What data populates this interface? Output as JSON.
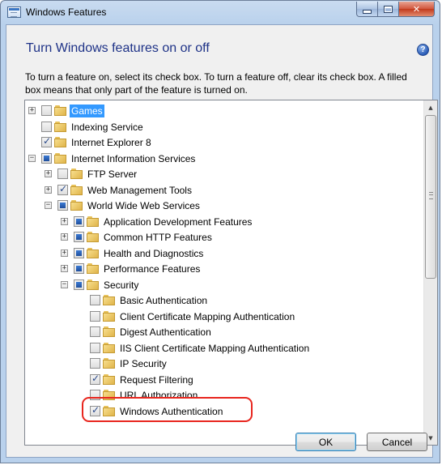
{
  "window": {
    "title": "Windows Features",
    "heading": "Turn Windows features on or off",
    "description": "To turn a feature on, select its check box. To turn a feature off, clear its check box. A filled box means that only part of the feature is turned on."
  },
  "icons": {
    "window_icon": "windows-features-icon",
    "help": "help-icon",
    "minimize": "minimize-icon",
    "maximize": "maximize-icon",
    "close": "close-icon",
    "folder": "folder-icon"
  },
  "caption": {
    "close_glyph": "✕"
  },
  "help_glyph": "?",
  "features": [
    {
      "label": "Games",
      "expander": "+",
      "state": "unchecked",
      "selected": true
    },
    {
      "label": "Indexing Service",
      "expander": "",
      "state": "unchecked"
    },
    {
      "label": "Internet Explorer 8",
      "expander": "",
      "state": "checked"
    },
    {
      "label": "Internet Information Services",
      "expander": "−",
      "state": "partial"
    },
    {
      "label": "FTP Server",
      "expander": "+",
      "state": "unchecked"
    },
    {
      "label": "Web Management Tools",
      "expander": "+",
      "state": "checked"
    },
    {
      "label": "World Wide Web Services",
      "expander": "−",
      "state": "partial"
    },
    {
      "label": "Application Development Features",
      "expander": "+",
      "state": "partial"
    },
    {
      "label": "Common HTTP Features",
      "expander": "+",
      "state": "partial"
    },
    {
      "label": "Health and Diagnostics",
      "expander": "+",
      "state": "partial"
    },
    {
      "label": "Performance Features",
      "expander": "+",
      "state": "partial"
    },
    {
      "label": "Security",
      "expander": "−",
      "state": "partial"
    },
    {
      "label": "Basic Authentication",
      "expander": "",
      "state": "unchecked"
    },
    {
      "label": "Client Certificate Mapping Authentication",
      "expander": "",
      "state": "unchecked"
    },
    {
      "label": "Digest Authentication",
      "expander": "",
      "state": "unchecked"
    },
    {
      "label": "IIS Client Certificate Mapping Authentication",
      "expander": "",
      "state": "unchecked"
    },
    {
      "label": "IP Security",
      "expander": "",
      "state": "unchecked"
    },
    {
      "label": "Request Filtering",
      "expander": "",
      "state": "checked"
    },
    {
      "label": "URL Authorization",
      "expander": "",
      "state": "unchecked"
    },
    {
      "label": "Windows Authentication",
      "expander": "",
      "state": "checked",
      "highlighted": true
    }
  ],
  "buttons": {
    "ok": "OK",
    "cancel": "Cancel"
  },
  "colors": {
    "heading": "#1e3287",
    "selection": "#3399ff",
    "highlight_ring": "#e8261e"
  }
}
